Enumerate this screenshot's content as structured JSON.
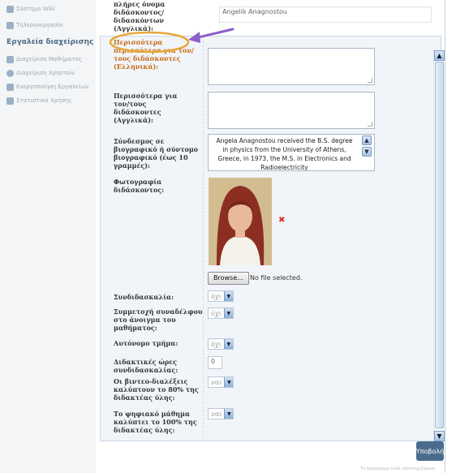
{
  "sidebar": {
    "items": [
      {
        "label": "Σύστημα Wiki",
        "icon": "wiki-icon"
      },
      {
        "label": "Τηλεσυνεργασία",
        "icon": "teleconference-icon"
      }
    ],
    "tools_heading": "Εργαλεία διαχείρισης",
    "tools": [
      {
        "label": "Διαχείριση Μαθήματος",
        "icon": "wrench-icon"
      },
      {
        "label": "Διαχείριση Χρηστών",
        "icon": "users-icon"
      },
      {
        "label": "Ενεργοποίηση Εργαλείων",
        "icon": "tools-activate-icon"
      },
      {
        "label": "Στατιστικά Χρήσης",
        "icon": "statistics-icon"
      }
    ]
  },
  "form": {
    "fullname_label": "πλήρες όνομα διδάσκοντος/διδασκόντων (Αγγλικά):",
    "fullname_value": "Angelik Anagnostou",
    "more_el_label": "Περισσότερα περισσότερα για τον/τους διδάσκοντες (Ελληνικά):",
    "more_en_label": "Περισσότερα για τον/τους διδάσκοντες (Αγγλικά):",
    "bio_label": "Σύνδεσμος σε βιογραφικό ή σύντομο βιογραφικό (έως 10 γραμμές):",
    "bio_text": "Angela Anagnostou received the B.S. degree in physics from the University of Athens, Greece, in 1973, the M.S. in Electronics and Radioelectricity",
    "photo_label": "Φωτογραφία διδάσκοντος:",
    "browse_label": "Browse...",
    "no_file_text": "No file selected.",
    "rows": [
      {
        "label": "Συνδιδασκαλία:",
        "value": "όχι"
      },
      {
        "label": "Συμμετοχή συναδέλφου στο άνοιγμα του μαθήματος:",
        "value": "όχι"
      },
      {
        "label": "Αυτόνομο τμήμα:",
        "value": "όχι"
      },
      {
        "label": "Διδακτικές ώρες συνδιδασκαλίας:",
        "value": "0"
      },
      {
        "label": "Οι βιντεο-διαλέξεις καλύπτουν το 80% της διδακτέας ύλης:",
        "value": "ναι"
      },
      {
        "label": "Το ψηφιακό μάθημα καλύπτει το 100% της διδακτέας ύλης:",
        "value": "ναι"
      }
    ],
    "submit_label": "Υποβολή"
  },
  "footer_text": "Το πρόγραμμα είναι υποστηριζόμενο",
  "colors": {
    "accent": "#c66a14",
    "submit_bg": "#4a6b8c",
    "annotation": "#8e5fc9"
  }
}
